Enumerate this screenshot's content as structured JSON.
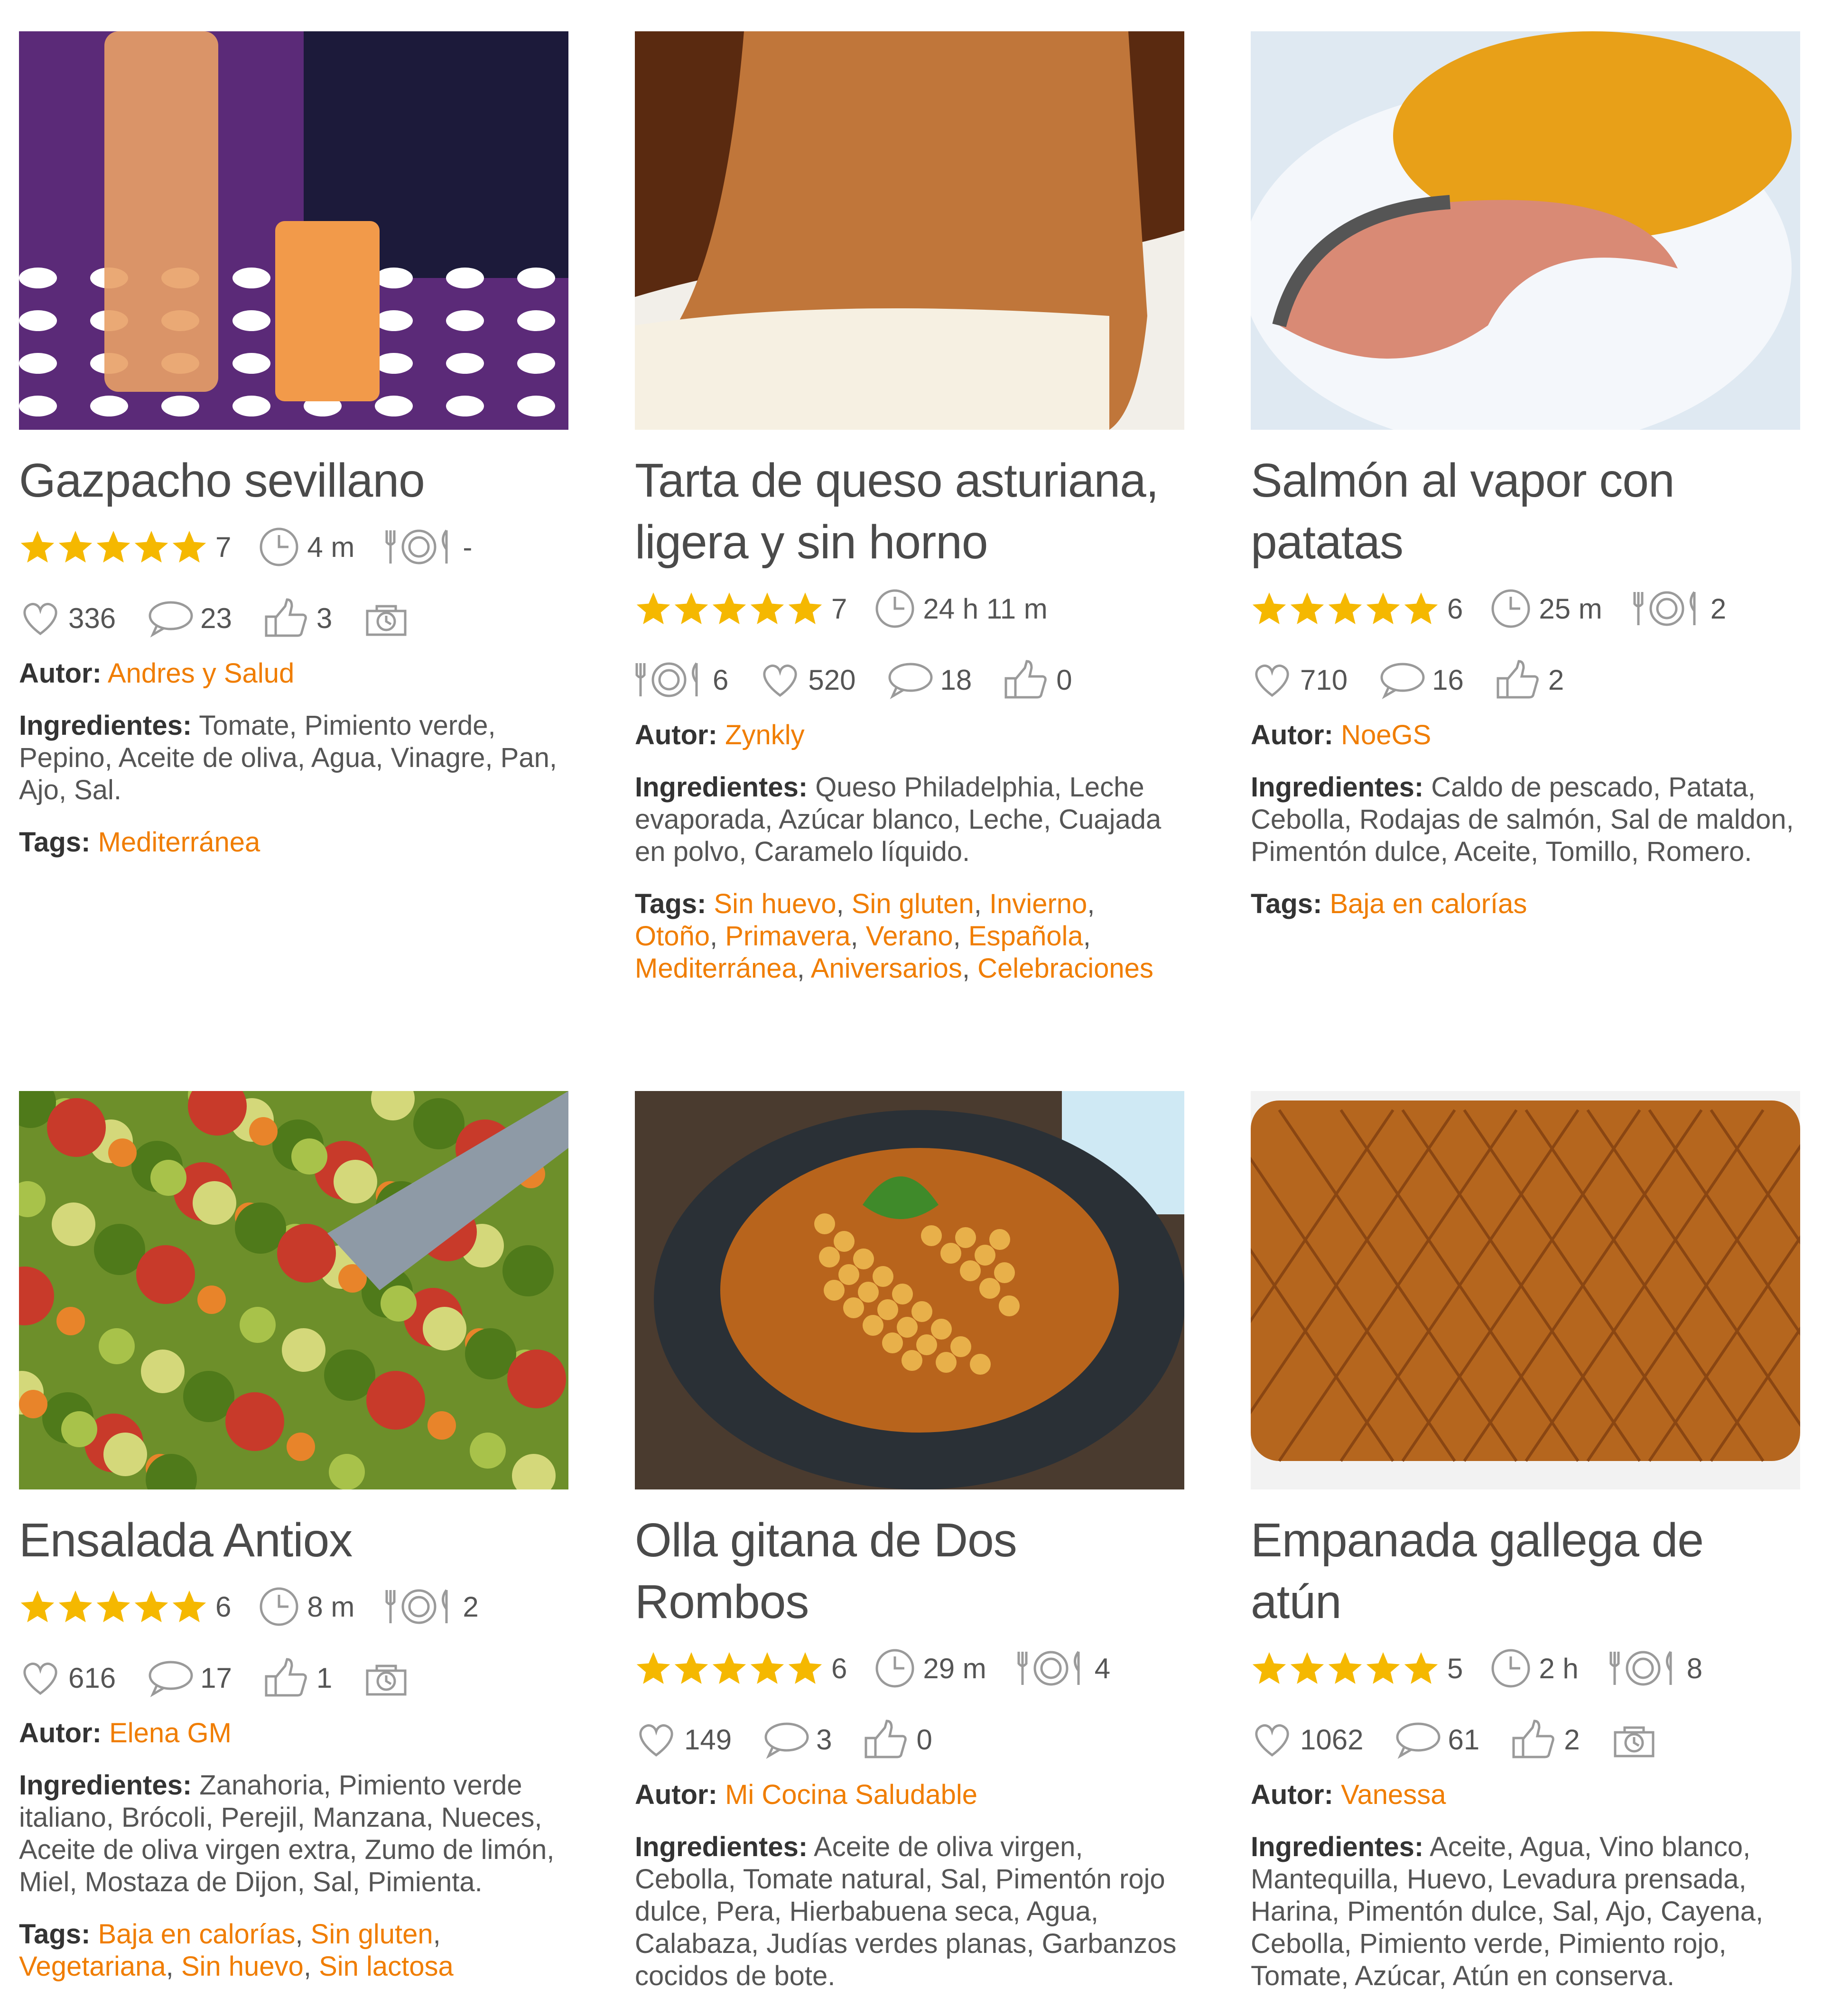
{
  "labels": {
    "autor": "Autor:",
    "ingredientes": "Ingredientes:",
    "tags": "Tags:"
  },
  "colors": {
    "accent": "#f07d00",
    "star": "#f5b800",
    "icon": "#9a9a9a"
  },
  "recipes": [
    {
      "title": "Gazpacho sevillano",
      "rating": 5,
      "votes": "7",
      "time": "4 m",
      "servings": "-",
      "likes": "336",
      "comments": "23",
      "thumbs": "3",
      "has_timer_icon": true,
      "author": "Andres y Salud",
      "ingredients": "Tomate, Pimiento verde, Pepino, Aceite de oliva, Agua, Vinagre, Pan, Ajo, Sal.",
      "tags": [
        "Mediterránea"
      ]
    },
    {
      "title": "Tarta de queso asturiana, ligera y sin horno",
      "rating": 5,
      "votes": "7",
      "time": "24 h 11 m",
      "servings": "6",
      "likes": "520",
      "comments": "18",
      "thumbs": "0",
      "has_timer_icon": false,
      "author": "Zynkly",
      "ingredients": "Queso Philadelphia, Leche evaporada, Azúcar blanco, Leche, Cuajada en polvo, Caramelo líquido.",
      "tags": [
        "Sin huevo",
        "Sin gluten",
        "Invierno",
        "Otoño",
        "Primavera",
        "Verano",
        "Española",
        "Mediterránea",
        "Aniversarios",
        "Celebraciones"
      ]
    },
    {
      "title": "Salmón al vapor con patatas",
      "rating": 5,
      "votes": "6",
      "time": "25 m",
      "servings": "2",
      "likes": "710",
      "comments": "16",
      "thumbs": "2",
      "has_timer_icon": false,
      "author": "NoeGS",
      "ingredients": "Caldo de pescado, Patata, Cebolla, Rodajas de salmón, Sal de maldon, Pimentón dulce, Aceite, Tomillo, Romero.",
      "tags": [
        "Baja en calorías"
      ]
    },
    {
      "title": "Ensalada Antiox",
      "rating": 5,
      "votes": "6",
      "time": "8 m",
      "servings": "2",
      "likes": "616",
      "comments": "17",
      "thumbs": "1",
      "has_timer_icon": true,
      "author": "Elena GM",
      "ingredients": "Zanahoria, Pimiento verde italiano, Brócoli, Perejil, Manzana, Nueces, Aceite de oliva virgen extra, Zumo de limón, Miel, Mostaza de Dijon, Sal, Pimienta.",
      "tags": [
        "Baja en calorías",
        "Sin gluten",
        "Vegetariana",
        "Sin huevo",
        "Sin lactosa"
      ]
    },
    {
      "title": "Olla gitana de Dos Rombos",
      "rating": 5,
      "votes": "6",
      "time": "29 m",
      "servings": "4",
      "likes": "149",
      "comments": "3",
      "thumbs": "0",
      "has_timer_icon": false,
      "author": "Mi Cocina Saludable",
      "ingredients": "Aceite de oliva virgen, Cebolla, Tomate natural, Sal, Pimentón rojo dulce, Pera, Hierbabuena seca, Agua, Calabaza, Judías verdes planas, Garbanzos cocidos de bote.",
      "tags": []
    },
    {
      "title": "Empanada gallega de atún",
      "rating": 5,
      "votes": "5",
      "time": "2 h",
      "servings": "8",
      "likes": "1062",
      "comments": "61",
      "thumbs": "2",
      "has_timer_icon": true,
      "author": "Vanessa",
      "ingredients": "Aceite, Agua, Vino blanco, Mantequilla, Huevo, Levadura prensada, Harina, Pimentón dulce, Sal, Ajo, Cayena, Cebolla, Pimiento verde, Pimiento rojo, Tomate, Azúcar, Atún en conserva.",
      "tags": []
    }
  ]
}
